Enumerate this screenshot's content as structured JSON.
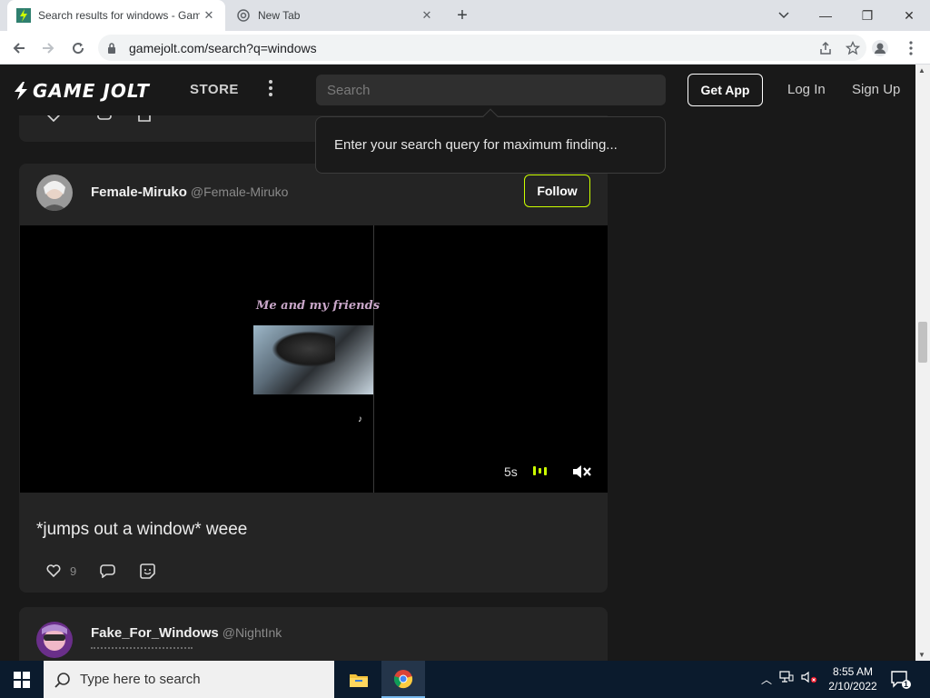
{
  "browser": {
    "tabs": [
      {
        "title": "Search results for windows - Gam",
        "active": true
      },
      {
        "title": "New Tab",
        "active": false
      }
    ],
    "url": "gamejolt.com/search?q=windows"
  },
  "header": {
    "logo_text": "GAME JOLT",
    "store_label": "STORE",
    "search_placeholder": "Search",
    "get_app_label": "Get App",
    "login_label": "Log In",
    "signup_label": "Sign Up"
  },
  "search_tooltip": "Enter your search query for maximum finding...",
  "prev_post": {
    "like_count": ""
  },
  "post": {
    "username": "Female-Miruko",
    "handle": "@Female-Miruko",
    "follow_label": "Follow",
    "video_caption": "Me and my friends",
    "video_time": "5s",
    "text": "*jumps out a window* weee",
    "like_count": "9"
  },
  "next_post": {
    "username": "Fake_For_Windows",
    "handle": "@NightInk"
  },
  "taskbar": {
    "search_placeholder": "Type here to search",
    "time": "8:55 AM",
    "date": "2/10/2022",
    "notification_count": "1"
  },
  "colors": {
    "accent": "#ccff00",
    "page_bg": "#191919",
    "card_bg": "#242424"
  }
}
